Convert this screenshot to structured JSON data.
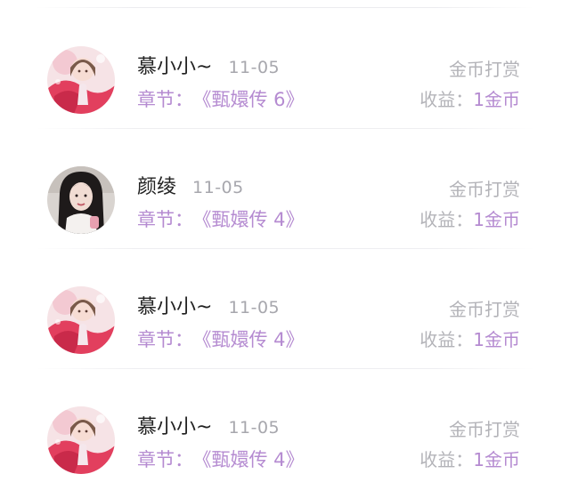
{
  "list": {
    "items": [
      {
        "name": "慕小小~",
        "date": "11-05",
        "chapter_label": "章节：",
        "chapter_value": "《甄嬛传 6》",
        "gift_type": "金币打赏",
        "income_label": "收益：",
        "income_value": "1金币",
        "avatar": "anime-girl-avatar"
      },
      {
        "name": "颜绫",
        "date": "11-05",
        "chapter_label": "章节：",
        "chapter_value": "《甄嬛传 4》",
        "gift_type": "金币打赏",
        "income_label": "收益：",
        "income_value": "1金币",
        "avatar": "photo-girl-avatar"
      },
      {
        "name": "慕小小~",
        "date": "11-05",
        "chapter_label": "章节：",
        "chapter_value": "《甄嬛传 4》",
        "gift_type": "金币打赏",
        "income_label": "收益：",
        "income_value": "1金币",
        "avatar": "anime-girl-avatar"
      },
      {
        "name": "慕小小~",
        "date": "11-05",
        "chapter_label": "章节：",
        "chapter_value": "《甄嬛传 4》",
        "gift_type": "金币打赏",
        "income_label": "收益：",
        "income_value": "1金币",
        "avatar": "anime-girl-avatar"
      }
    ]
  },
  "colors": {
    "accent_purple": "#b58bd1",
    "muted_gray": "#b3b3b8",
    "name_dark": "#222222"
  }
}
